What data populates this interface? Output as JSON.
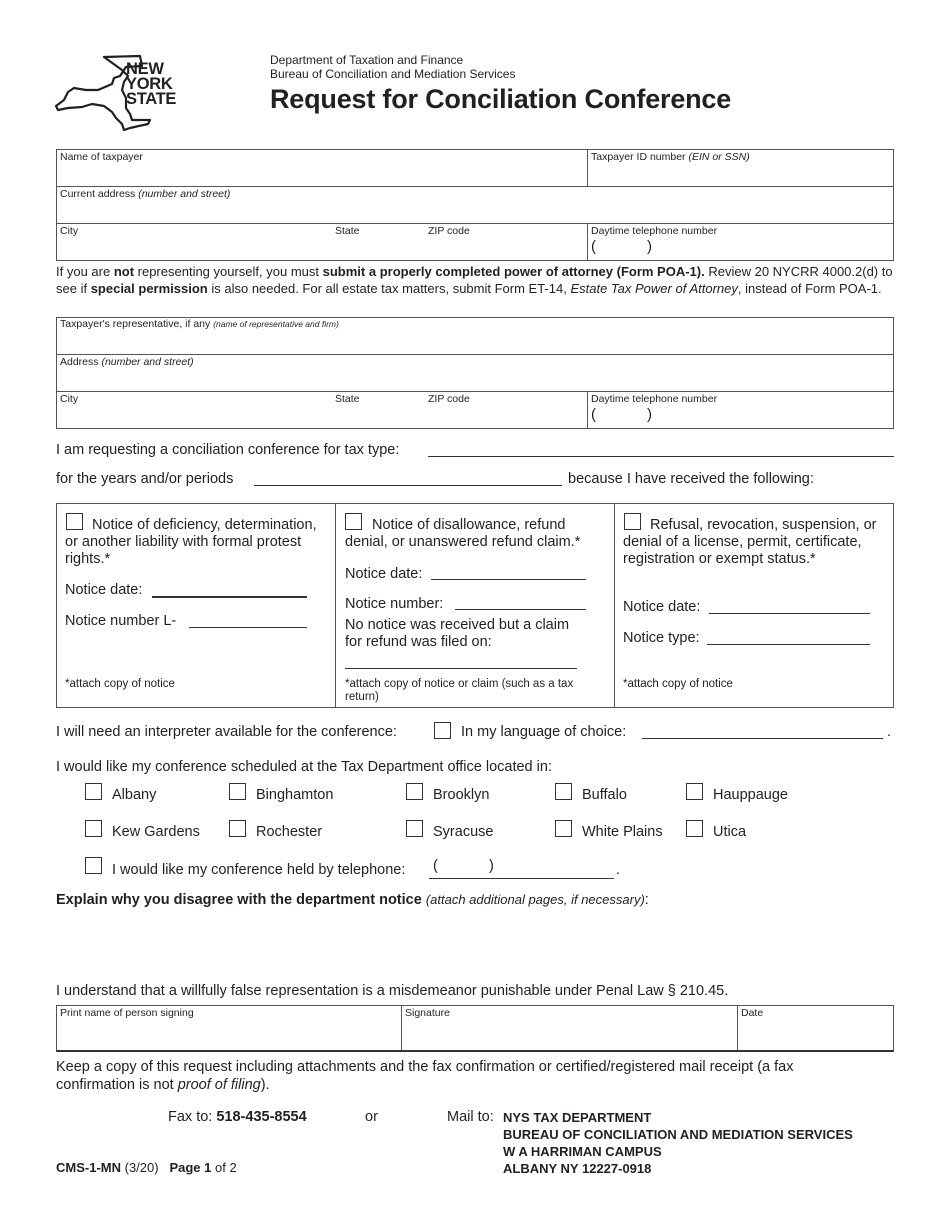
{
  "header": {
    "logo_text": [
      "NEW",
      "YORK",
      "STATE"
    ],
    "department": "Department of Taxation and Finance",
    "bureau": "Bureau of Conciliation and Mediation Services",
    "title": "Request for Conciliation Conference"
  },
  "taxpayer": {
    "name_label": "Name of taxpayer",
    "id_label": "Taxpayer ID number",
    "id_hint": "(EIN or SSN)",
    "address_label": "Current address",
    "address_hint": "(number and street)",
    "city_label": "City",
    "state_label": "State",
    "zip_label": "ZIP code",
    "phone_label": "Daytime telephone number",
    "phone_open": "(",
    "phone_close": ")"
  },
  "poa_notice": {
    "t1": "If you are ",
    "t2": "not",
    "t3": " representing yourself, you must ",
    "t4": "submit a properly completed power of attorney (Form POA-1).",
    "t5": " Review 20 NYCRR 4000.2(d) to see if ",
    "t6": "special permission",
    "t7": " is also needed. For all estate tax matters, submit Form ET-14, ",
    "t8": "Estate Tax Power of Attorney",
    "t9": ", instead of Form POA-1."
  },
  "representative": {
    "rep_label": "Taxpayer's representative, if any",
    "rep_hint": "(name of representative and firm)",
    "address_label": "Address",
    "address_hint": "(number and street)",
    "city_label": "City",
    "state_label": "State",
    "zip_label": "ZIP code",
    "phone_label": "Daytime telephone number",
    "phone_open": "(",
    "phone_close": ")"
  },
  "request": {
    "tax_type_label": "I am requesting a conciliation conference for tax type:",
    "tax_type_value": "",
    "years_label": "for the years and/or periods",
    "years_value": "",
    "because_label": "because I have received the following:"
  },
  "notices": [
    {
      "title": "Notice of deficiency, determination, or another liability with formal protest rights.*",
      "field1_label": "Notice date:",
      "field2_label": "Notice number L-",
      "footnote": "*attach copy of notice"
    },
    {
      "title": "Notice of disallowance, refund denial, or unanswered refund claim.*",
      "field1_label": "Notice date:",
      "field2_label": "Notice number:",
      "extra": "No notice was received but a claim for refund was filed on:",
      "footnote": "*attach copy of notice or claim (such as a tax return)"
    },
    {
      "title": "Refusal, revocation, suspension, or denial of a license, permit, certificate, registration or exempt status.*",
      "field1_label": "Notice date:",
      "field2_label": "Notice type:",
      "footnote": "*attach copy of notice"
    }
  ],
  "interpreter": {
    "label": "I will need an interpreter available for the conference:",
    "language_label": "In my language of choice:",
    "language_value": "",
    "period": "."
  },
  "offices": {
    "label": "I would like my conference scheduled at the Tax Department office located in:",
    "options": [
      "Albany",
      "Binghamton",
      "Brooklyn",
      "Buffalo",
      "Hauppauge",
      "Kew Gardens",
      "Rochester",
      "Syracuse",
      "White Plains",
      "Utica"
    ],
    "telephone_label": "I would like my conference held by telephone:",
    "phone_open": "(",
    "phone_close": ")",
    "period": "."
  },
  "explain": {
    "label": "Explain why you disagree with the department notice",
    "hint": "(attach additional pages, if necessary)",
    "colon": ":"
  },
  "certification": {
    "statement": "I understand that a willfully false representation is a misdemeanor punishable under Penal Law § 210.45.",
    "print_name_label": "Print name of person signing",
    "signature_label": "Signature",
    "date_label": "Date"
  },
  "keep_copy": {
    "t1": "Keep a copy of this request including attachments and the fax confirmation or certified/registered mail receipt (a fax confirmation is not ",
    "t2": "proof of filing",
    "t3": ")."
  },
  "submit": {
    "fax_label": "Fax to:",
    "fax_number": "518-435-8554",
    "or": "or",
    "mail_label": "Mail to:",
    "mail_lines": [
      "NYS TAX DEPARTMENT",
      "BUREAU OF CONCILIATION AND MEDIATION SERVICES",
      "W A HARRIMAN CAMPUS",
      "ALBANY NY 12227-0918"
    ]
  },
  "footer": {
    "form_id": "CMS-1-MN",
    "revision": "(3/20)",
    "page_word": "Page",
    "page_num": "1",
    "page_of": "of 2"
  }
}
